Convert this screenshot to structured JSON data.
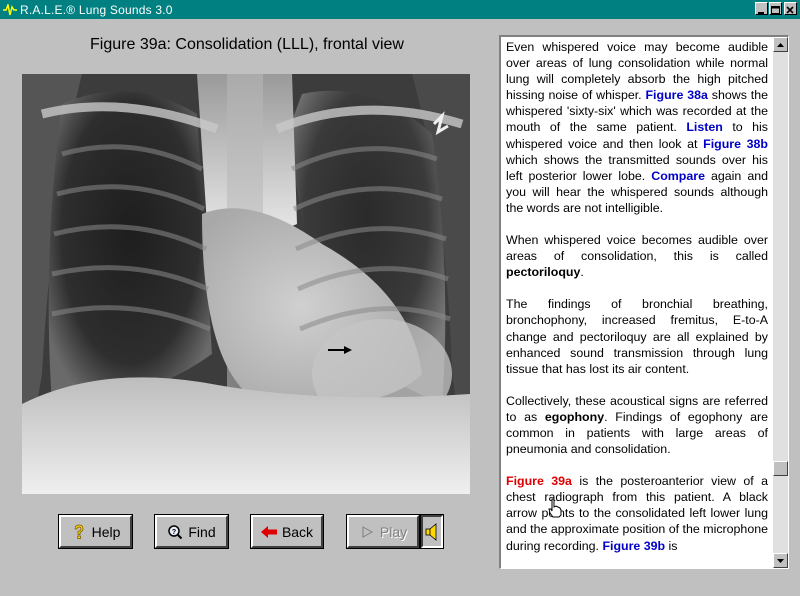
{
  "window": {
    "title": "R.A.L.E.® Lung Sounds 3.0",
    "title_bar_color": "#008080"
  },
  "figure": {
    "title": "Figure 39a: Consolidation (LLL), frontal view"
  },
  "buttons": {
    "help": "Help",
    "find": "Find",
    "back": "Back",
    "play": "Play"
  },
  "text_panel": {
    "p1": {
      "a": "Even whispered voice may become audible over areas of lung consolidation while normal lung will completely absorb the high pitched hissing noise of whisper. ",
      "link1": "Figure 38a",
      "b": " shows the whispered 'sixty-six' which was recorded at the mouth of the same patient. ",
      "link2": "Listen",
      "c": " to his whispered voice and then look at ",
      "link3": "Figure 38b",
      "d": " which shows the transmitted sounds over his left posterior lower lobe. ",
      "link4": "Compare",
      "e": " again and you will hear the whispered sounds although the words are not intelligible."
    },
    "p2": {
      "a": "When whispered voice becomes audible over areas of consolidation, this is called ",
      "term": "pectoriloquy",
      "b": "."
    },
    "p3": {
      "text": "The findings of bronchial breathing, bronchophony, increased fremitus, E-to-A change and pectoriloquy are all explained by enhanced sound transmission through lung tissue that has lost its air content."
    },
    "p4": {
      "a": "Collectively, these acoustical signs are referred to as ",
      "term": "egophony",
      "b": ". Findings of egophony are common in patients with large areas of pneumonia and consolidation."
    },
    "p5": {
      "link1": "Figure 39a",
      "a": " is the posteroanterior view of a chest radiograph from this patient. A black arrow points to the consolidated left lower lung and the approximate position of the microphone during recording. ",
      "link2": "Figure 39b",
      "b": " is"
    }
  },
  "colors": {
    "link": "#0000c8",
    "current_figure_link": "#e00000",
    "background": "#c0c0c0"
  }
}
